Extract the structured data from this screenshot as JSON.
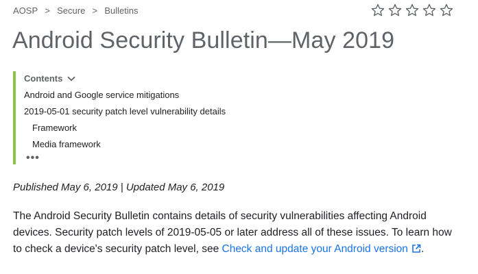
{
  "breadcrumb": {
    "items": [
      "AOSP",
      "Secure",
      "Bulletins"
    ],
    "separator": ">"
  },
  "rating": {
    "stars": 5,
    "filled": 0,
    "star_color": "#5f6368"
  },
  "title": "Android Security Bulletin—May 2019",
  "toc": {
    "header": "Contents",
    "items": [
      "Android and Google service mitigations",
      "2019-05-01 security patch level vulnerability details",
      "Framework",
      "Media framework"
    ],
    "more": "•••",
    "accent_color": "#8bc34a"
  },
  "published": "Published May 6, 2019 | Updated May 6, 2019",
  "body": {
    "text_before_link": "The Android Security Bulletin contains details of security vulnerabilities affecting Android devices. Security patch levels of 2019-05-05 or later address all of these issues. To learn how to check a device's security patch level, see ",
    "link_text": "Check and update your Android version",
    "text_after_link": ".",
    "link_color": "#1a73e8"
  }
}
